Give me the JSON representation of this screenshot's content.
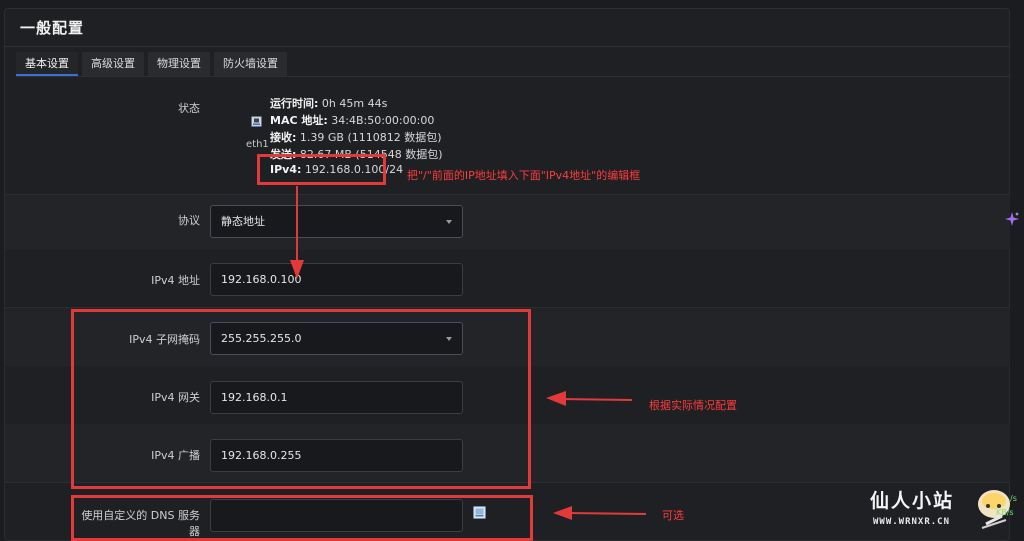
{
  "panel": {
    "title": "一般配置"
  },
  "tabs": [
    {
      "label": "基本设置",
      "active": true
    },
    {
      "label": "高级设置",
      "active": false
    },
    {
      "label": "物理设置",
      "active": false
    },
    {
      "label": "防火墙设置",
      "active": false
    }
  ],
  "status": {
    "label": "状态",
    "interface": "eth1",
    "uptime_key": "运行时间:",
    "uptime_val": " 0h 45m 44s",
    "mac_key": "MAC 地址:",
    "mac_val": " 34:4B:50:00:00:00",
    "rx_key": "接收:",
    "rx_val": " 1.39 GB (1110812 数据包)",
    "tx_key": "发送:",
    "tx_val": " 82.67 MB (514548 数据包)",
    "ipv4_key": "IPv4:",
    "ipv4_val": " 192.168.0.100/24"
  },
  "form": {
    "protocol": {
      "label": "协议",
      "value": "静态地址"
    },
    "ipv4_address": {
      "label": "IPv4 地址",
      "value": "192.168.0.100"
    },
    "netmask": {
      "label": "IPv4 子网掩码",
      "value": "255.255.255.0"
    },
    "gateway": {
      "label": "IPv4 网关",
      "value": "192.168.0.1"
    },
    "broadcast": {
      "label": "IPv4 广播",
      "value": "192.168.0.255"
    },
    "dns": {
      "label": "使用自定义的 DNS 服务器",
      "value": ""
    }
  },
  "annotations": {
    "ipv4_hint": "把\"/\"前面的IP地址填入下面\"IPv4地址\"的编辑框",
    "config_hint": "根据实际情况配置",
    "optional_hint": "可选"
  },
  "watermark": {
    "title": "仙人小站",
    "url": "WWW.WRNXR.CN",
    "speed_up": "/s",
    "speed_down": "KB/s"
  },
  "colors": {
    "accent": "#3b6fd6",
    "annotation": "#e23a3a",
    "background": "#1b1c1f"
  }
}
